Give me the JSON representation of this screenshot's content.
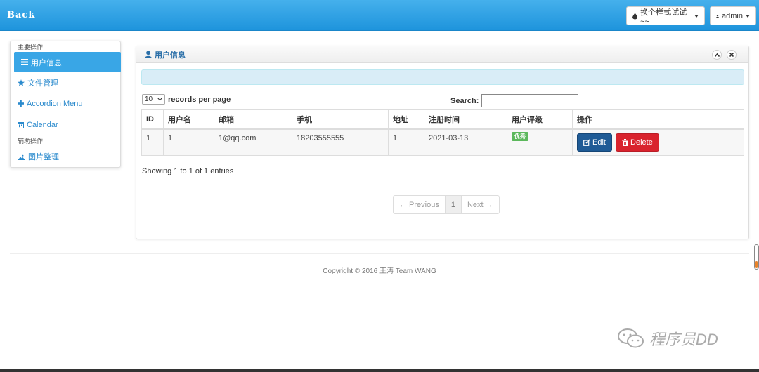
{
  "navbar": {
    "brand": "Back",
    "style_button": "换个样式试试 ~~",
    "user_button": "admin"
  },
  "sidebar": {
    "header_main": "主要操作",
    "items": [
      {
        "label": "用户信息",
        "icon": "list-icon"
      },
      {
        "label": "文件管理",
        "icon": "star-icon"
      },
      {
        "label": "Accordion Menu",
        "icon": "plus-icon"
      },
      {
        "label": "Calendar",
        "icon": "calendar-icon"
      }
    ],
    "header_aux": "辅助操作",
    "aux_items": [
      {
        "label": "图片整理",
        "icon": "picture-icon"
      }
    ]
  },
  "panel": {
    "title": "用户信息",
    "length_value": "10",
    "length_label": "records per page",
    "search_label": "Search:",
    "search_value": "",
    "columns": [
      "ID",
      "用户名",
      "邮箱",
      "手机",
      "地址",
      "注册时间",
      "用户评级",
      "操作"
    ],
    "rows": [
      {
        "id": "1",
        "username": "1",
        "email": "1@qq.com",
        "phone": "18203555555",
        "address": "1",
        "registered": "2021-03-13",
        "rating": "优秀",
        "edit": "Edit",
        "delete": "Delete"
      }
    ],
    "info": "Showing 1 to 1 of 1 entries",
    "pager": {
      "prev": "← Previous",
      "current": "1",
      "next": "Next →"
    }
  },
  "footer": {
    "text": "Copyright © 2016   王涛    Team WANG"
  },
  "watermark": {
    "text": "程序员DD"
  },
  "colors": {
    "navbar": "#1e94dc",
    "active_item": "#39a6e6",
    "edit": "#1f5b96",
    "delete": "#d9232d",
    "badge": "#5cb85c"
  }
}
